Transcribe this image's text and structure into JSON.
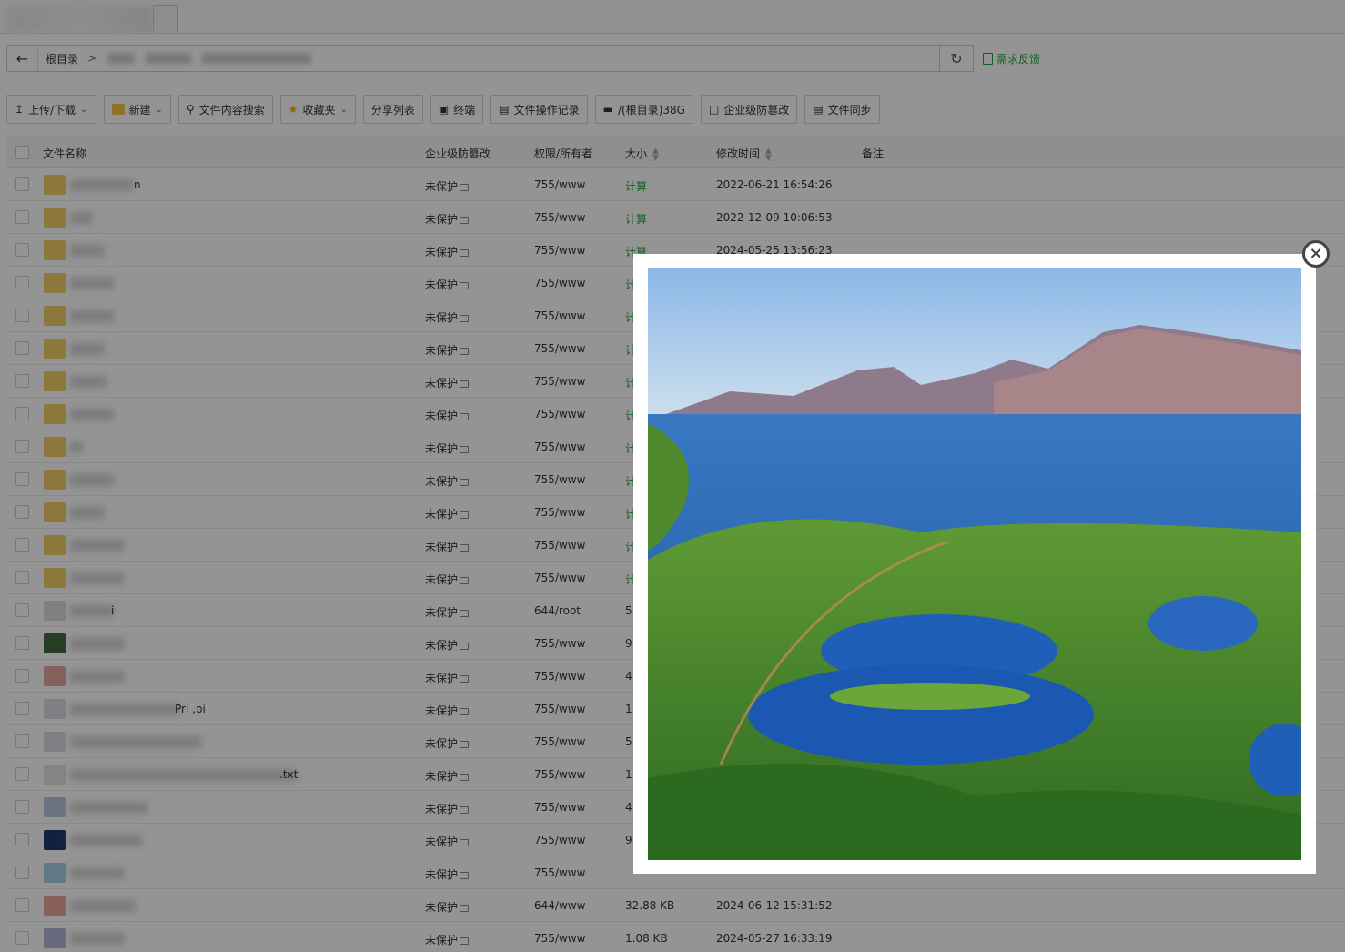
{
  "path_bar": {
    "root_label": "根目录",
    "separator": ">"
  },
  "feedback_label": "需求反馈",
  "toolbar": {
    "upload_label": "上传/下载",
    "new_label": "新建",
    "search_label": "文件内容搜索",
    "favorites_label": "收藏夹",
    "share_list_label": "分享列表",
    "terminal_label": "终端",
    "file_log_label": "文件操作记录",
    "disk_label": "/(根目录)38G",
    "tamper_label": "企业级防篡改",
    "sync_label": "文件同步"
  },
  "table": {
    "columns": {
      "name": "文件名称",
      "protection": "企业级防篡改",
      "permission": "权限/所有者",
      "size": "大小",
      "mtime": "修改时间",
      "note": "备注"
    },
    "rows": [
      {
        "name_fragment": "n",
        "protection": "未保护",
        "permission": "755/www",
        "size": "计算",
        "mtime": "2022-06-21 16:54:26",
        "thumb": "#f2cf66"
      },
      {
        "name_fragment": "",
        "protection": "未保护",
        "permission": "755/www",
        "size": "计算",
        "mtime": "2022-12-09 10:06:53",
        "thumb": "#f2cf66"
      },
      {
        "name_fragment": "",
        "protection": "未保护",
        "permission": "755/www",
        "size": "计算",
        "mtime": "2024-05-25 13:56:23",
        "thumb": "#f2cf66"
      },
      {
        "name_fragment": "",
        "protection": "未保护",
        "permission": "755/www",
        "size": "计",
        "mtime": "",
        "thumb": "#f2cf66"
      },
      {
        "name_fragment": "",
        "protection": "未保护",
        "permission": "755/www",
        "size": "计",
        "mtime": "",
        "thumb": "#f2cf66"
      },
      {
        "name_fragment": "",
        "protection": "未保护",
        "permission": "755/www",
        "size": "计",
        "mtime": "",
        "thumb": "#f2cf66"
      },
      {
        "name_fragment": "",
        "protection": "未保护",
        "permission": "755/www",
        "size": "计",
        "mtime": "",
        "thumb": "#f2cf66"
      },
      {
        "name_fragment": "",
        "protection": "未保护",
        "permission": "755/www",
        "size": "计",
        "mtime": "",
        "thumb": "#f2cf66"
      },
      {
        "name_fragment": "",
        "protection": "未保护",
        "permission": "755/www",
        "size": "计",
        "mtime": "",
        "thumb": "#f2cf66"
      },
      {
        "name_fragment": "",
        "protection": "未保护",
        "permission": "755/www",
        "size": "计",
        "mtime": "",
        "thumb": "#f2cf66"
      },
      {
        "name_fragment": "",
        "protection": "未保护",
        "permission": "755/www",
        "size": "计",
        "mtime": "",
        "thumb": "#f2cf66"
      },
      {
        "name_fragment": "",
        "protection": "未保护",
        "permission": "755/www",
        "size": "计",
        "mtime": "",
        "thumb": "#f2cf66"
      },
      {
        "name_fragment": "",
        "protection": "未保护",
        "permission": "755/www",
        "size": "计",
        "mtime": "",
        "thumb": "#f2cf66"
      },
      {
        "name_fragment": "i",
        "protection": "未保护",
        "permission": "644/root",
        "size": "5",
        "mtime": "",
        "thumb": "#dcdcdc"
      },
      {
        "name_fragment": "",
        "protection": "未保护",
        "permission": "755/www",
        "size": "9",
        "mtime": "",
        "thumb": "#3f6a3f"
      },
      {
        "name_fragment": "",
        "protection": "未保护",
        "permission": "755/www",
        "size": "4",
        "mtime": "",
        "thumb": "#e5a7a0"
      },
      {
        "name_fragment": "Pri  ,pi",
        "protection": "未保护",
        "permission": "755/www",
        "size": "1",
        "mtime": "",
        "thumb": "#d9dde5"
      },
      {
        "name_fragment": "",
        "protection": "未保护",
        "permission": "755/www",
        "size": "5",
        "mtime": "",
        "thumb": "#d9dde5"
      },
      {
        "name_fragment": ".txt",
        "protection": "未保护",
        "permission": "755/www",
        "size": "1",
        "mtime": "",
        "thumb": "#e3e3e3"
      },
      {
        "name_fragment": "",
        "protection": "未保护",
        "permission": "755/www",
        "size": "4",
        "mtime": "",
        "thumb": "#b9c6e0"
      },
      {
        "name_fragment": "",
        "protection": "未保护",
        "permission": "755/www",
        "size": "9.",
        "mtime": "",
        "thumb": "#223a6e"
      },
      {
        "name_fragment": "",
        "protection": "未保护",
        "permission": "755/www",
        "size": "",
        "mtime": "",
        "thumb": "#a8d0e6"
      },
      {
        "name_fragment": "",
        "protection": "未保护",
        "permission": "644/www",
        "size": "32.88 KB",
        "mtime": "2024-06-12 15:31:52",
        "thumb": "#e8a59a"
      },
      {
        "name_fragment": "",
        "protection": "未保护",
        "permission": "755/www",
        "size": "1.08 KB",
        "mtime": "2024-05-27 16:33:19",
        "thumb": "#b6b6d8"
      }
    ]
  },
  "preview": {
    "close_glyph": "×"
  },
  "colors": {
    "accent_green": "#20a53a",
    "overlay": "rgba(0,0,0,0.42)"
  }
}
